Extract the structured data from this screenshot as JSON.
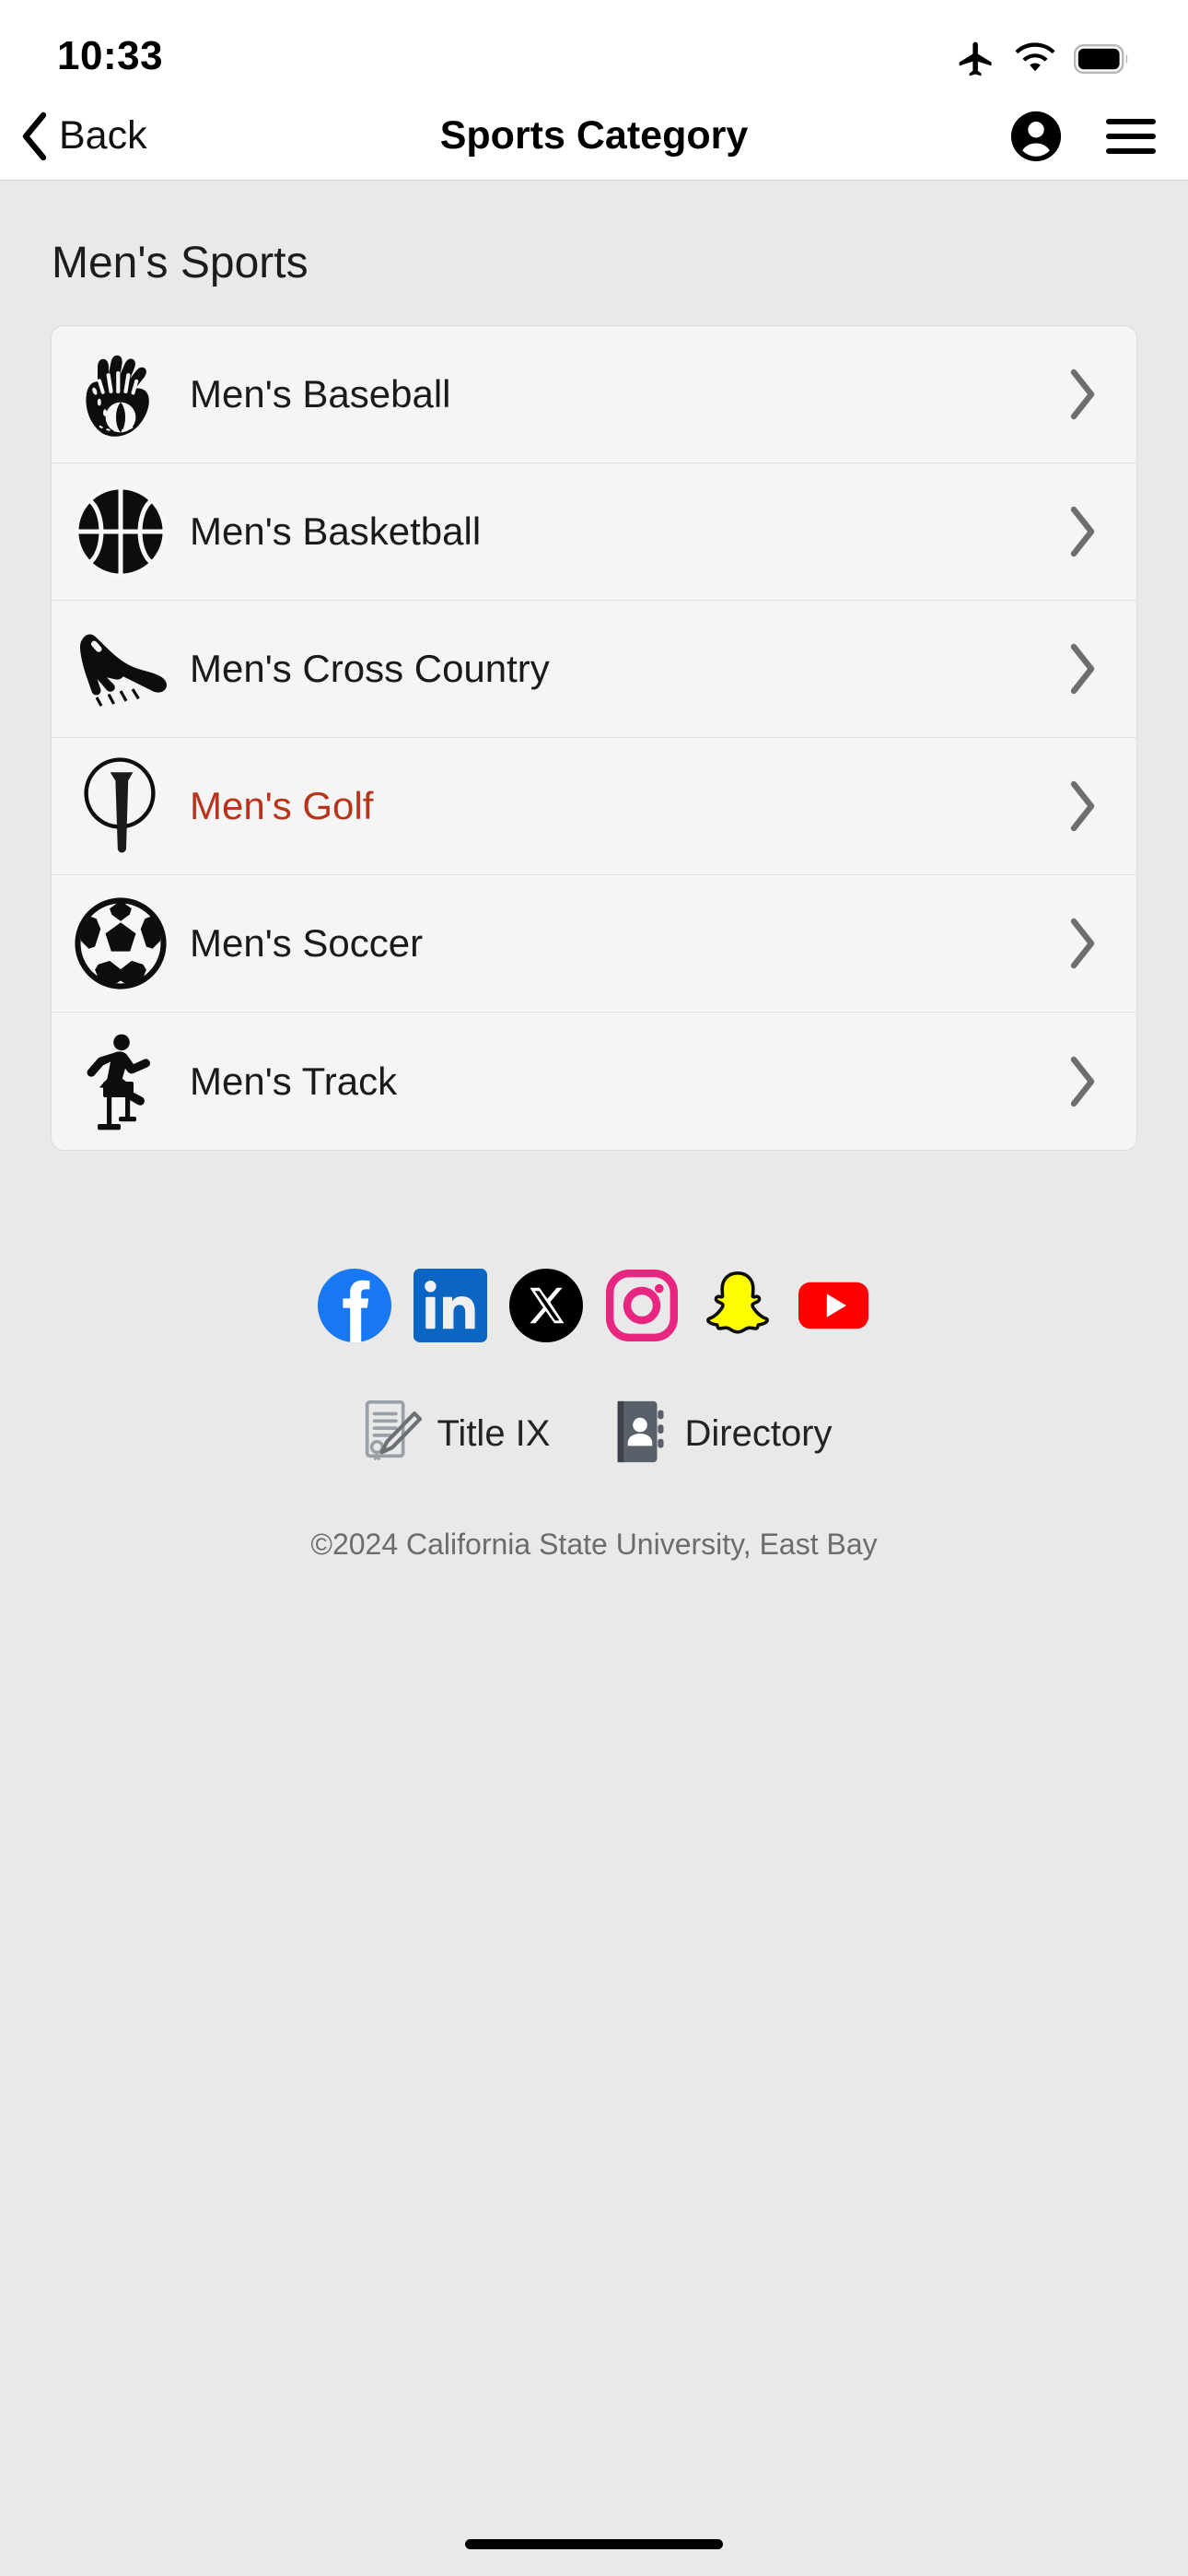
{
  "status_bar": {
    "time": "10:33",
    "icons": [
      "airplane-mode-icon",
      "wifi-icon",
      "battery-icon"
    ]
  },
  "nav_bar": {
    "back_label": "Back",
    "title": "Sports Category",
    "account_icon": "account-circle-icon",
    "menu_icon": "hamburger-menu-icon"
  },
  "main": {
    "section_title": "Men's Sports",
    "accent_color": "#B8331A",
    "rows": [
      {
        "label": "Men's Baseball",
        "icon": "baseball-glove-icon",
        "highlighted": false
      },
      {
        "label": "Men's Basketball",
        "icon": "basketball-icon",
        "highlighted": false
      },
      {
        "label": "Men's Cross Country",
        "icon": "running-shoe-icon",
        "highlighted": false
      },
      {
        "label": "Men's Golf",
        "icon": "golf-ball-tee-icon",
        "highlighted": true
      },
      {
        "label": "Men's Soccer",
        "icon": "soccer-ball-icon",
        "highlighted": false
      },
      {
        "label": "Men's Track",
        "icon": "track-hurdler-icon",
        "highlighted": false
      }
    ],
    "chevron_icon": "chevron-right-icon"
  },
  "footer": {
    "social": [
      {
        "name": "facebook-icon",
        "color": "#1877F2"
      },
      {
        "name": "linkedin-icon",
        "color": "#0A66C2"
      },
      {
        "name": "x-twitter-icon",
        "color": "#000000"
      },
      {
        "name": "instagram-icon",
        "color": "#E8257F"
      },
      {
        "name": "snapchat-icon",
        "color": "#FFFC00"
      },
      {
        "name": "youtube-icon",
        "color": "#FF0000"
      }
    ],
    "links": [
      {
        "label": "Title IX",
        "icon": "document-pen-icon"
      },
      {
        "label": "Directory",
        "icon": "address-book-icon"
      }
    ],
    "copyright": "©2024 California State University, East Bay"
  }
}
